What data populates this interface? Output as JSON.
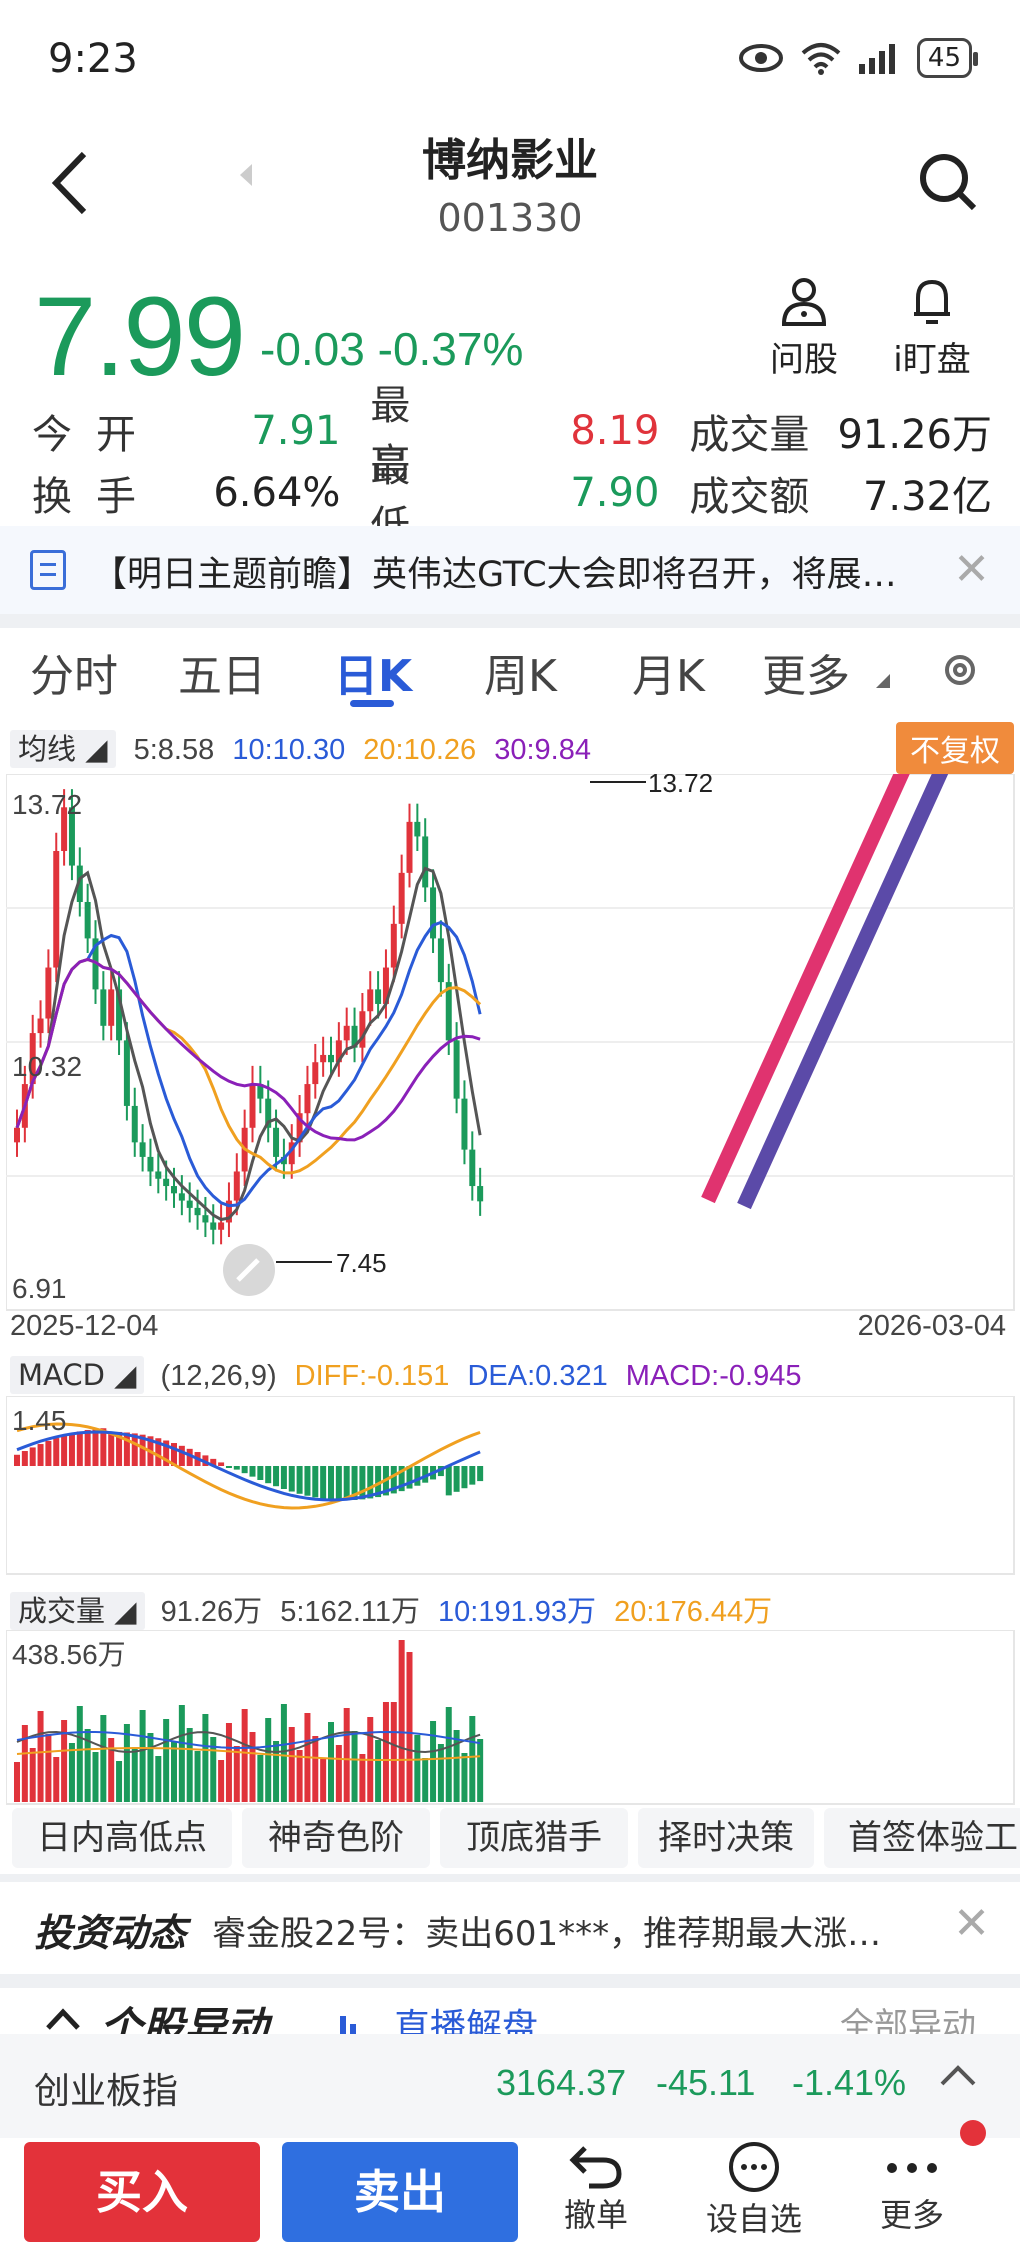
{
  "status_bar": {
    "time": "9:23",
    "battery": "45"
  },
  "header": {
    "title": "博纳影业",
    "code": "001330"
  },
  "quote": {
    "price": "7.99",
    "change": "-0.03 -0.37%"
  },
  "actions_top": {
    "ask": "问股",
    "watch": "i盯盘"
  },
  "stats": {
    "rows": [
      {
        "l1": "今开",
        "v1": "7.91",
        "l2": "最高",
        "v2": "8.19",
        "l3": "成交量",
        "v3": "91.26万"
      },
      {
        "l1": "换手",
        "v1": "6.64%",
        "l2": "最低",
        "v2": "7.90",
        "l3": "成交额",
        "v3": "7.32亿"
      }
    ]
  },
  "news": {
    "text": "【明日主题前瞻】英伟达GTC大会即将召开，将展…"
  },
  "tabs": [
    "分时",
    "五日",
    "日K",
    "周K",
    "月K",
    "更多"
  ],
  "active_tab": "日K",
  "ma_row": {
    "label": "均线",
    "ma5": "5:8.58",
    "ma10": "10:10.30",
    "ma20": "20:10.26",
    "ma30": "30:9.84",
    "adjust": "不复权"
  },
  "colors": {
    "up": "#e0333b",
    "down": "#1b9a5b",
    "accent": "#2a5bd7",
    "ma5": "#555555",
    "ma10": "#2a5bd7",
    "ma20": "#f0a020",
    "ma30": "#8a20b8"
  },
  "kline": {
    "y_high_label": "13.72",
    "y_mid_label": "10.32",
    "y_low_label": "6.91",
    "high_marker": "13.72",
    "low_marker": "7.45",
    "date_start": "2025-12-04",
    "date_end": "2026-03-04"
  },
  "macd_row": {
    "label": "MACD",
    "params": "(12,26,9)",
    "diff": "DIFF:-0.151",
    "dea": "DEA:0.321",
    "macd": "MACD:-0.945",
    "y_label": "1.45"
  },
  "vol_row": {
    "label": "成交量",
    "v": "91.26万",
    "ma5": "5:162.11万",
    "ma10": "10:191.93万",
    "ma20": "20:176.44万",
    "y_label": "438.56万"
  },
  "tools": [
    "日内高低点",
    "神奇色阶",
    "顶底猎手",
    "择时决策",
    "首签体验工"
  ],
  "dynamics": {
    "brand": "投资动态",
    "text": "睿金股22号：卖出601***，推荐期最大涨…"
  },
  "section": {
    "title": "个股异动",
    "live": "直播解盘",
    "all": "全部异动"
  },
  "index_bar": {
    "name": "创业板指",
    "value": "3164.37",
    "change": "-45.11",
    "pct": "-1.41%"
  },
  "bottom": {
    "buy": "买入",
    "sell": "卖出",
    "cancel": "撤单",
    "fav": "设自选",
    "more": "更多"
  }
}
